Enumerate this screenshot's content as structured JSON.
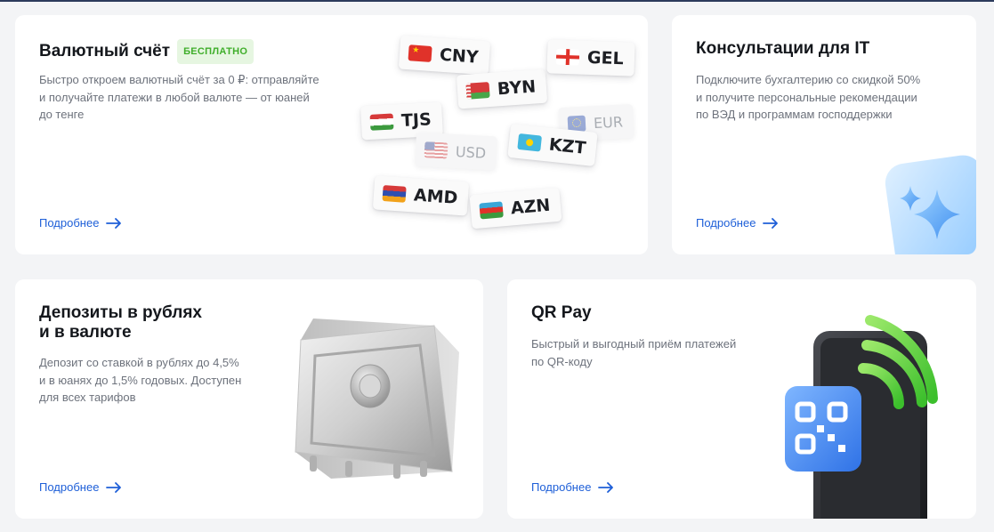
{
  "cards": {
    "fx": {
      "title": "Валютный счёт",
      "badge": "БЕСПЛАТНО",
      "desc": [
        "Быстро откроем валютный счёт за 0 ₽: отправляйте",
        "и получайте платежи в любой валюте — от юаней",
        "до тенге"
      ],
      "link": "Подробнее",
      "currencies": [
        "CNY",
        "BYN",
        "GEL",
        "TJS",
        "EUR",
        "USD",
        "KZT",
        "AMD",
        "AZN"
      ]
    },
    "it": {
      "title": "Консультации для IT",
      "desc": [
        "Подключите бухгалтерию со скидкой 50%",
        "и получите персональные рекомендации",
        "по ВЭД и программам господдержки"
      ],
      "link": "Подробнее"
    },
    "deposit": {
      "title": [
        "Депозиты в рублях",
        "и в валюте"
      ],
      "desc": [
        "Депозит со ставкой в рублях до 4,5%",
        "и в юанях до 1,5% годовых. Доступен",
        "для всех тарифов"
      ],
      "link": "Подробнее"
    },
    "qr": {
      "title": "QR Pay",
      "desc": [
        "Быстрый и выгодный приём платежей",
        "по QR-коду"
      ],
      "link": "Подробнее"
    }
  },
  "colors": {
    "link": "#1e5fd8",
    "badge_text": "#3fae2a",
    "badge_bg": "#e6f6e1",
    "card": "#ffffff",
    "page": "#f3f4f6"
  },
  "icons": [
    "arrow-right-icon",
    "stars-icon",
    "safe-illustration",
    "qr-code-icon",
    "wifi-signal-icon",
    "phone-illustration"
  ]
}
